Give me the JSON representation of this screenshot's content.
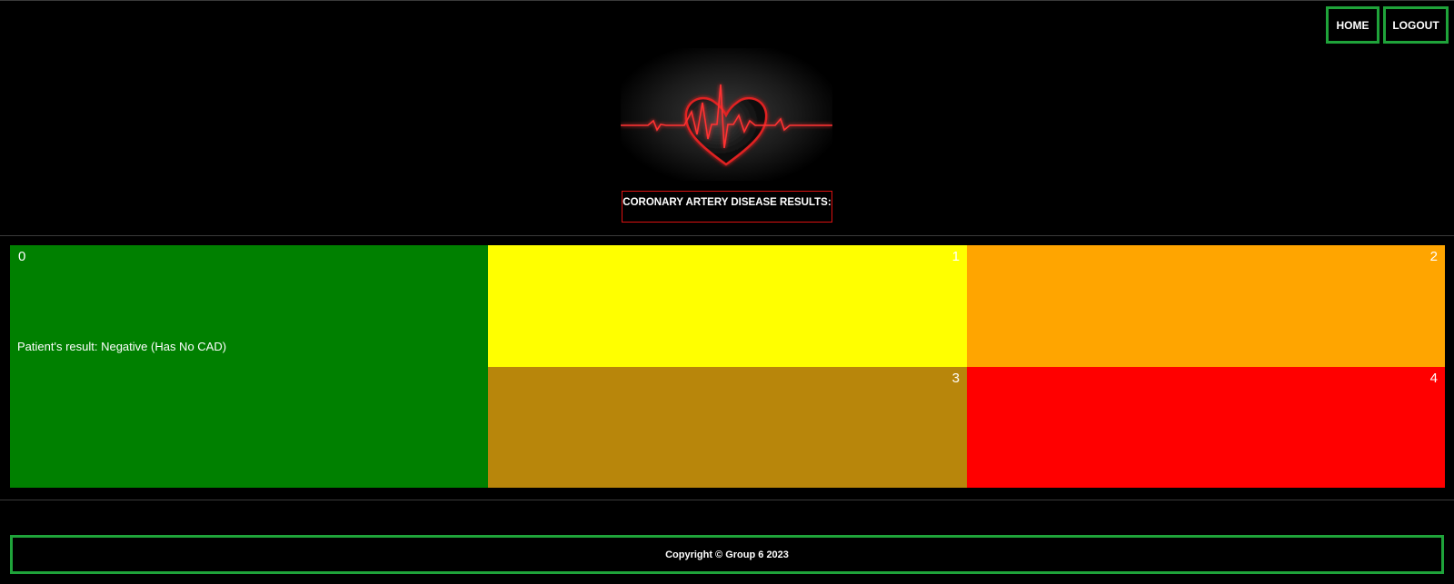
{
  "nav": {
    "home_label": "HOME",
    "logout_label": "LOGOUT",
    "border_color": "#1fa33a"
  },
  "logo": {
    "icon": "heartbeat-heart-icon"
  },
  "header": {
    "title": "CORONARY ARTERY DISEASE RESULTS:"
  },
  "grid": {
    "cells": [
      {
        "num": "0",
        "color": "#008000"
      },
      {
        "num": "1",
        "color": "#ffff00"
      },
      {
        "num": "2",
        "color": "#ffa500"
      },
      {
        "num": "3",
        "color": "#b8860b"
      },
      {
        "num": "4",
        "color": "#ff0000"
      }
    ],
    "result_text": "Patient's result: Negative (Has No CAD)"
  },
  "footer": {
    "text": "Copyright © Group 6 2023"
  }
}
